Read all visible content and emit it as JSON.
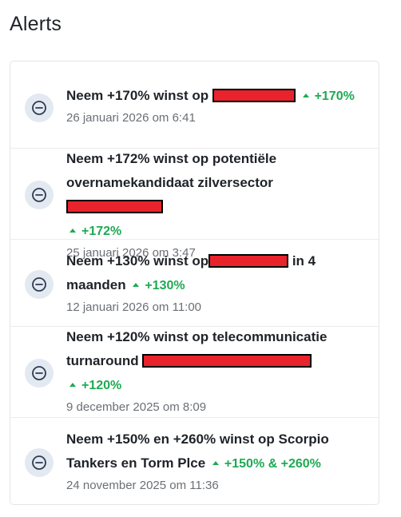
{
  "page": {
    "title": "Alerts"
  },
  "colors": {
    "gain": "#1eaa53",
    "redaction": "#e8232c",
    "icon_bg": "#e3e9f1",
    "icon_stroke": "#2f3b52"
  },
  "alerts": [
    {
      "title_before": "Neem +170% winst op",
      "title_after": "",
      "gain": "+170%",
      "date": "26 januari 2026 om 6:41"
    },
    {
      "title_before": "Neem +172% winst op potentiële overnamekandidaat zilversector",
      "title_after": "",
      "gain": "+172%",
      "date": "25 januari 2026 om 3:47"
    },
    {
      "title_before": "Neem +130% winst op",
      "title_after": "in 4 maanden",
      "gain": "+130%",
      "date": "12 januari 2026 om 11:00"
    },
    {
      "title_before": "Neem +120% winst op telecommunicatie turnaround",
      "title_after": "",
      "gain": "+120%",
      "date": "9 december 2025 om 8:09"
    },
    {
      "title_before": "Neem +150% en +260% winst op Scorpio Tankers en Torm Plce",
      "title_after": "",
      "gain": "+150% & +260%",
      "date": "24 november 2025 om 11:36"
    }
  ]
}
